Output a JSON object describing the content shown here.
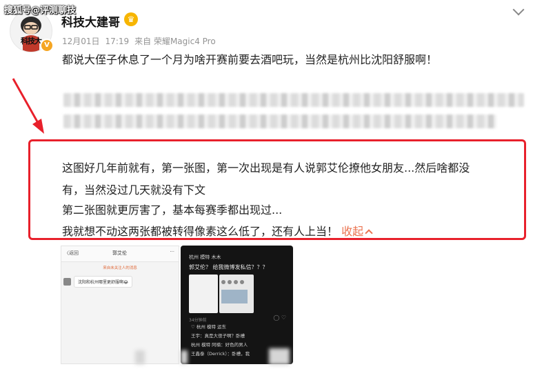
{
  "watermark": "搜狐号@评测聊技",
  "author": {
    "name": "科技大建哥",
    "avatar_text": "科技大",
    "verified_badge": "V"
  },
  "post": {
    "date": "12月01日",
    "time": "17:19",
    "source": "来自 荣耀Magic4 Pro",
    "text": "都说大侄子休息了一个月为啥开赛前要去酒吧玩，当然是杭州比沈阳舒服啊！"
  },
  "quoted": {
    "lines": [
      "这图好几年前就有，第一张图，第一次出现是有人说郭艾伦撩他女朋友...然后啥都没",
      "有，当然没过几天就没有下文",
      "第二张图就更厉害了，基本每赛季都出现过...",
      "我就想不动这两张都被转得像素这么低了，还有人上当！"
    ],
    "collapse_label": "收起"
  },
  "image1": {
    "back": "〈返回",
    "title": "郭艾伦",
    "more": "···",
    "note": "来自未关注人的消息",
    "message": "沈阳和杭州哪里更舒服啊😂"
  },
  "image2": {
    "header": "杭州 模特 木木",
    "question": "郭艾伦？ 给我微博发私信？？？",
    "time": "34分钟前",
    "comments": [
      "♡ 杭州 模特 运东",
      "王宇：真是大侄子啊？卧槽",
      "杭州 模特 阿楠：好色的男人",
      "王鑫泰（Derrick）：卧槽，我"
    ]
  },
  "colors": {
    "accent": "#eb7350",
    "highlight_border": "#e8202b",
    "crown": "#f7b500",
    "verified": "#f5a623"
  }
}
